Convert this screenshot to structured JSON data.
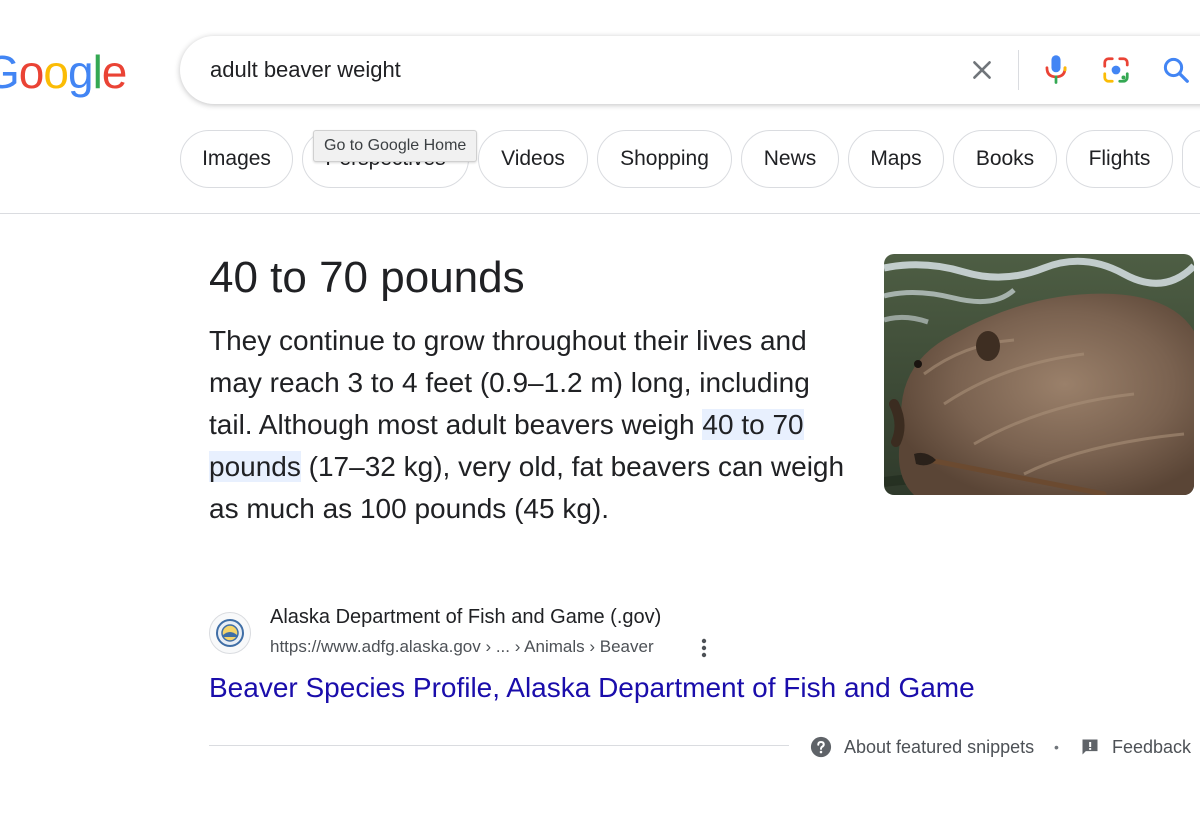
{
  "logo": {
    "text": "Google",
    "letters": [
      "G",
      "o",
      "o",
      "g",
      "l",
      "e"
    ]
  },
  "search": {
    "query": "adult beaver weight",
    "clear_icon": "close-icon",
    "mic_icon": "microphone-icon",
    "lens_icon": "google-lens-icon",
    "search_icon": "search-icon"
  },
  "tooltip": {
    "text": "Go to Google Home"
  },
  "chips": [
    {
      "label": "Images"
    },
    {
      "label": "Perspectives"
    },
    {
      "label": "Videos"
    },
    {
      "label": "Shopping"
    },
    {
      "label": "News"
    },
    {
      "label": "Maps"
    },
    {
      "label": "Books"
    },
    {
      "label": "Flights"
    }
  ],
  "featured": {
    "answer": "40 to 70 pounds",
    "snippet_before": "They continue to grow throughout their lives and may reach 3 to 4 feet (0.9–1.2 m) long, including tail. Although most adult beavers weigh ",
    "snippet_highlight": "40 to 70 pounds",
    "snippet_after": " (17–32 kg), very old, fat beavers can weigh as much as 100 pounds (45 kg).",
    "image_icon": "beaver-photo"
  },
  "source": {
    "name": "Alaska Department of Fish and Game (.gov)",
    "url": "https://www.adfg.alaska.gov › ... › Animals › Beaver",
    "link_title": "Beaver Species Profile, Alaska Department of Fish and Game"
  },
  "footer": {
    "about_label": "About featured snippets",
    "separator": "•",
    "feedback_label": "Feedback"
  },
  "colors": {
    "link": "#1a0dab",
    "highlight": "#e8f0fe",
    "google_blue": "#4285F4",
    "google_red": "#EA4335",
    "google_yellow": "#FBBC05",
    "google_green": "#34A853"
  }
}
